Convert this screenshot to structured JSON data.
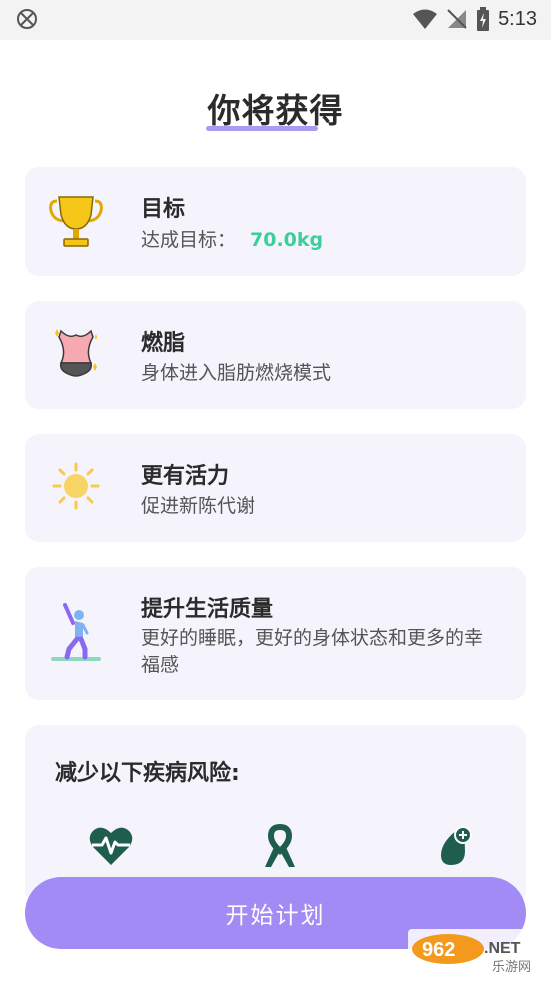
{
  "status_bar": {
    "time": "5:13"
  },
  "page": {
    "title": "你将获得"
  },
  "benefits": [
    {
      "title": "目标",
      "desc_prefix": "达成目标：",
      "value": "70.0kg",
      "icon": "trophy-icon"
    },
    {
      "title": "燃脂",
      "desc": "身体进入脂肪燃烧模式",
      "icon": "body-fat-icon"
    },
    {
      "title": "更有活力",
      "desc": "促进新陈代谢",
      "icon": "sun-icon"
    },
    {
      "title": "提升生活质量",
      "desc": "更好的睡眠，更好的身体状态和更多的幸福感",
      "icon": "stretching-person-icon"
    }
  ],
  "disease": {
    "title": "减少以下疾病风险:",
    "icons": [
      "heart-rate-icon",
      "awareness-ribbon-icon",
      "diabetes-drop-icon"
    ]
  },
  "action": {
    "start_label": "开始计划"
  },
  "watermark": {
    "text": "962.NET",
    "subtext": "乐游网"
  },
  "colors": {
    "accent": "#a28bf4",
    "card_bg": "#f5f4fd",
    "value_green": "#3ccf9a",
    "icon_green": "#1f5e4f"
  }
}
